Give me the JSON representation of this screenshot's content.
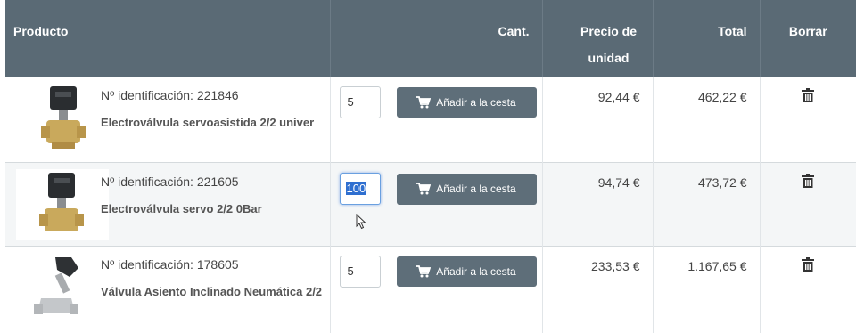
{
  "header": {
    "product": "Producto",
    "qty": "Cant.",
    "unit_price_line1": "Precio de",
    "unit_price_line2": "unidad",
    "total": "Total",
    "delete": "Borrar"
  },
  "rows": [
    {
      "id_text": "Nº identificación: 221846",
      "name": "Electroválvula servoasistida 2/2 univer",
      "qty": "5",
      "add_label": "Añadir a la cesta",
      "unit_price": "92,44 €",
      "total": "462,22 €"
    },
    {
      "id_text": "Nº identificación: 221605",
      "name": "Electroválvula servo 2/2 0Bar",
      "qty": "100",
      "add_label": "Añadir a la cesta",
      "unit_price": "94,74 €",
      "total": "473,72 €"
    },
    {
      "id_text": "Nº identificación: 178605",
      "name": "Válvula Asiento Inclinado Neumática 2/2",
      "qty": "5",
      "add_label": "Añadir a la cesta",
      "unit_price": "233,53 €",
      "total": "1.167,65 €"
    }
  ],
  "icons": {
    "cart": "shopping-cart-icon",
    "delete": "trash-icon",
    "cursor": "mouse-pointer-icon"
  },
  "colors": {
    "header_bg": "#5a6a75",
    "button_bg": "#5e6e79",
    "selection": "#2f6fd0"
  }
}
